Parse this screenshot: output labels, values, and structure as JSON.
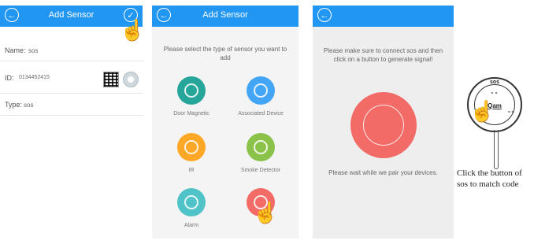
{
  "screen1": {
    "title": "Add Sensor",
    "name_label": "Name:",
    "name_value": "sos",
    "id_label": "ID:",
    "id_value": "0134452415",
    "type_label": "Type:",
    "type_value": "sos"
  },
  "screen2": {
    "title": "Add Sensor",
    "prompt": "Please select the type of sensor you want to add",
    "sensors": [
      {
        "label": "Door Magnetic",
        "color": "#26a69a"
      },
      {
        "label": "Associated Device",
        "color": "#42a5f5"
      },
      {
        "label": "IR",
        "color": "#ffa726"
      },
      {
        "label": "Smoke Detector",
        "color": "#8bc34a"
      },
      {
        "label": "Alarm",
        "color": "#4fc3c7"
      },
      {
        "label": "",
        "color": "#f26b66"
      }
    ]
  },
  "screen3": {
    "instruction": "Please make sure to connect sos and then click on a button to generate signal!",
    "waiting": "Please wait while we pair your devices."
  },
  "device": {
    "top_label": "sos",
    "logo": "Qam"
  },
  "caption": "Click the button of sos to match code",
  "icons": {
    "back": "back-arrow-icon",
    "confirm": "checkmark-icon",
    "pointer": "pointing-hand-icon"
  },
  "colors": {
    "appbar": "#2196f3",
    "accent_red": "#f26b66"
  }
}
